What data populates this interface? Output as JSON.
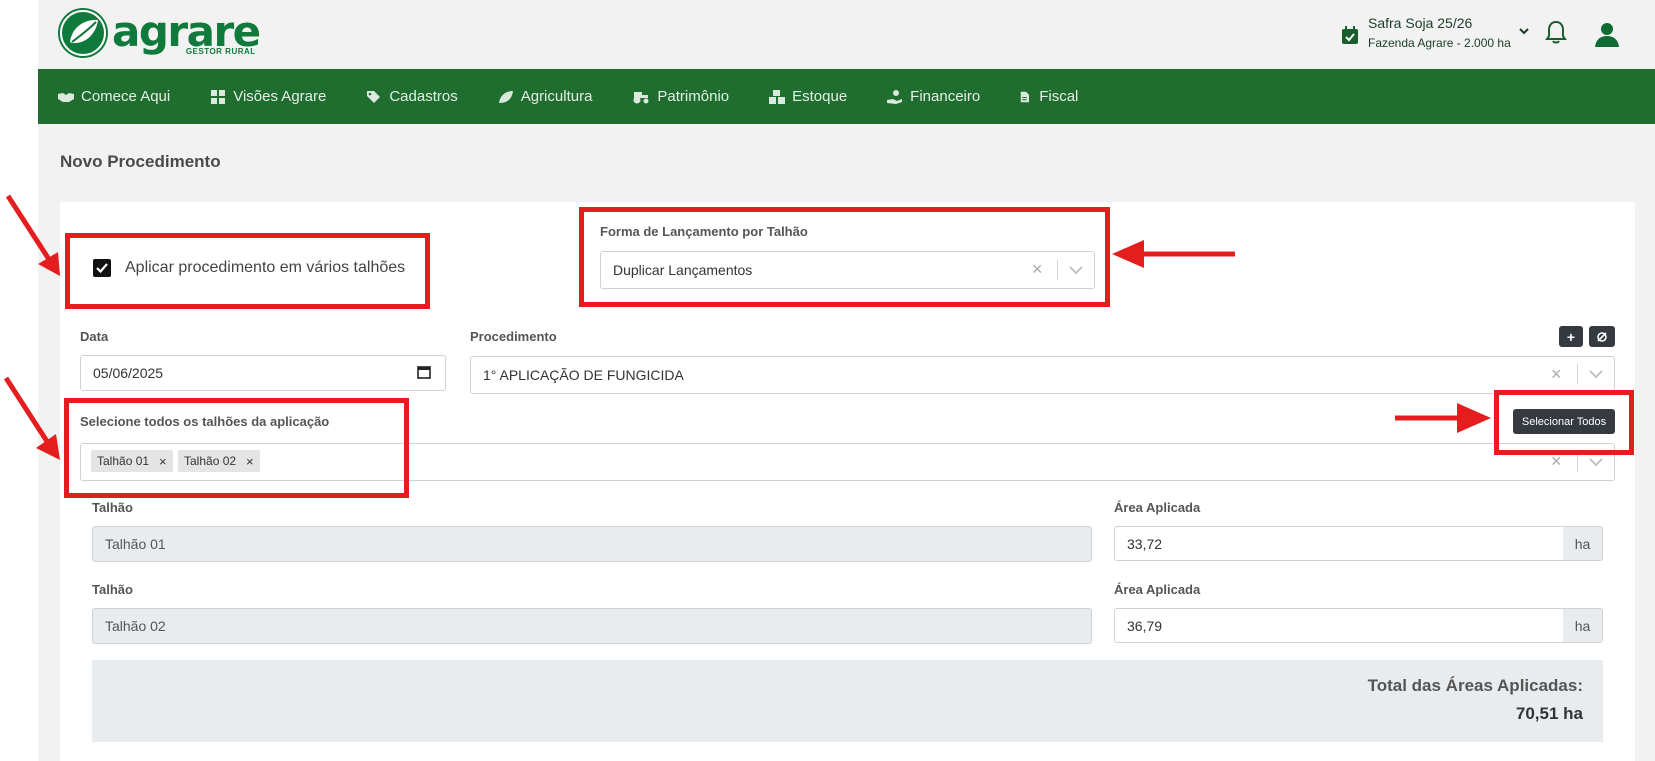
{
  "header": {
    "logo_word": "agrare",
    "logo_sub": "GESTOR RURAL",
    "safra_title": "Safra Soja 25/26",
    "safra_farm": "Fazenda Agrare - 2.000 ha"
  },
  "nav": {
    "items": [
      {
        "label": "Comece Aqui",
        "icon": "handshake-icon"
      },
      {
        "label": "Visões Agrare",
        "icon": "grid-icon"
      },
      {
        "label": "Cadastros",
        "icon": "tags-icon"
      },
      {
        "label": "Agricultura",
        "icon": "leaf-icon"
      },
      {
        "label": "Patrimônio",
        "icon": "tractor-icon"
      },
      {
        "label": "Estoque",
        "icon": "boxes-icon"
      },
      {
        "label": "Financeiro",
        "icon": "hand-coin-icon"
      },
      {
        "label": "Fiscal",
        "icon": "file-icon"
      }
    ]
  },
  "page": {
    "title": "Novo Procedimento"
  },
  "form": {
    "multi_checkbox_label": "Aplicar procedimento em vários talhões",
    "multi_checked": true,
    "forma_label": "Forma de Lançamento por Talhão",
    "forma_value": "Duplicar Lançamentos",
    "data_label": "Data",
    "data_value": "05/06/2025",
    "procedimento_label": "Procedimento",
    "procedimento_value": "1° APLICAÇÃO DE FUNGICIDA",
    "add_button": "+",
    "refresh_icon": "sync-icon",
    "talhoes_label": "Selecione todos os talhões da aplicação",
    "selecionar_todos": "Selecionar Todos",
    "selected_talhoes": [
      "Talhão 01",
      "Talhão 02"
    ],
    "tag_remove": "×",
    "rows": [
      {
        "talhao_label": "Talhão",
        "talhao_value": "Talhão 01",
        "area_label": "Área Aplicada",
        "area_value": "33,72",
        "unit": "ha"
      },
      {
        "talhao_label": "Talhão",
        "talhao_value": "Talhão 02",
        "area_label": "Área Aplicada",
        "area_value": "36,79",
        "unit": "ha"
      }
    ],
    "total_label": "Total das Áreas Aplicadas:",
    "total_value": "70,51 ha"
  },
  "colors": {
    "brand_green": "#0f7a3b",
    "nav_green": "#1f6e2f",
    "annotation_red": "#e41e1e",
    "dark_button": "#343a40"
  }
}
